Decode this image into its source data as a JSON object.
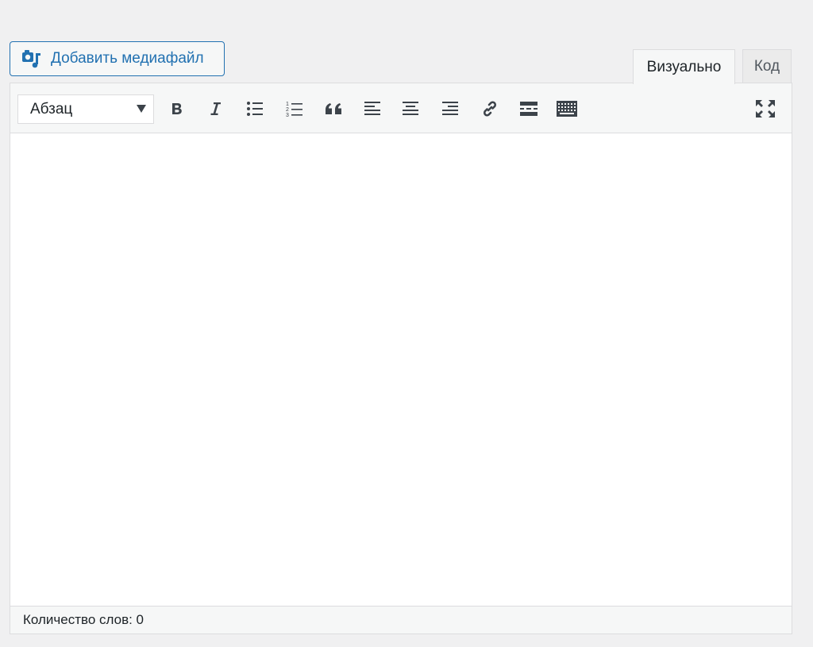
{
  "media_button": {
    "label": "Добавить медиафайл",
    "icon": "media-add-icon"
  },
  "tabs": [
    {
      "label": "Визуально",
      "active": true
    },
    {
      "label": "Код",
      "active": false
    }
  ],
  "toolbar": {
    "format_select": {
      "selected": "Абзац"
    },
    "buttons": [
      {
        "name": "bold",
        "icon": "bold-icon"
      },
      {
        "name": "italic",
        "icon": "italic-icon"
      },
      {
        "name": "bulleted-list",
        "icon": "bulleted-list-icon"
      },
      {
        "name": "numbered-list",
        "icon": "numbered-list-icon"
      },
      {
        "name": "blockquote",
        "icon": "quote-icon"
      },
      {
        "name": "align-left",
        "icon": "align-left-icon"
      },
      {
        "name": "align-center",
        "icon": "align-center-icon"
      },
      {
        "name": "align-right",
        "icon": "align-right-icon"
      },
      {
        "name": "insert-link",
        "icon": "link-icon"
      },
      {
        "name": "read-more",
        "icon": "read-more-icon"
      },
      {
        "name": "toolbar-toggle",
        "icon": "keyboard-icon"
      },
      {
        "name": "fullscreen",
        "icon": "fullscreen-icon"
      }
    ]
  },
  "editor": {
    "content": ""
  },
  "status": {
    "word_count": "Количество слов: 0"
  },
  "colors": {
    "accent": "#2271b1",
    "icon": "#3c434a",
    "border": "#dcdcde",
    "background": "#f0f0f1"
  }
}
